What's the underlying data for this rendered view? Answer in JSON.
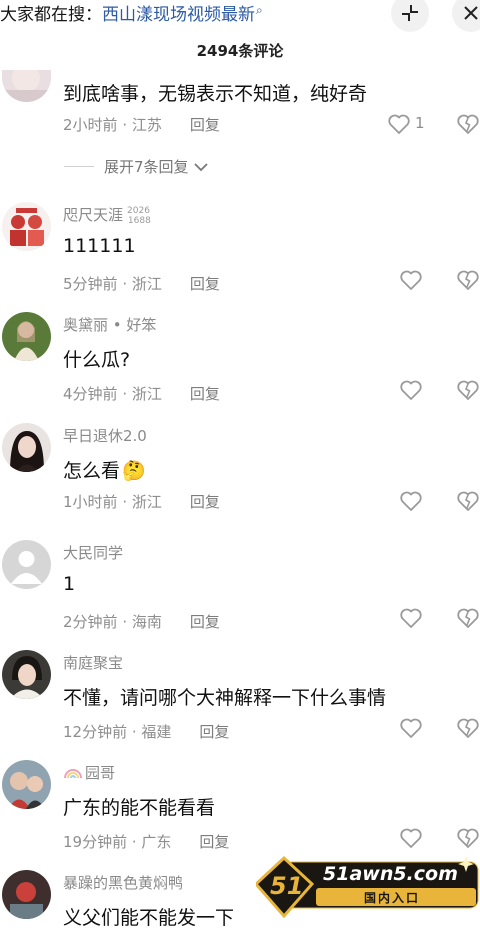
{
  "search": {
    "label": "大家都在搜：",
    "term": "西山漾现场视频最新",
    "icon": "search-icon"
  },
  "header": {
    "comment_count": "2494条评论"
  },
  "expand": {
    "label": "展开7条回复"
  },
  "comments": [
    {
      "username": "",
      "text": "到底啥事，无锡表示不知道，纯好奇",
      "time": "2小时前",
      "location": "江苏",
      "reply": "回复",
      "likes": "1"
    },
    {
      "username": "咫尺天涯",
      "badge_top": "2026",
      "badge_bottom": "1688",
      "text": "111111",
      "time": "5分钟前",
      "location": "浙江",
      "reply": "回复"
    },
    {
      "username": "奥黛丽 • 好笨",
      "text": "什么瓜?",
      "time": "4分钟前",
      "location": "浙江",
      "reply": "回复"
    },
    {
      "username": "早日退休2.0",
      "text": "怎么看",
      "emoji": "🤔",
      "time": "1小时前",
      "location": "浙江",
      "reply": "回复"
    },
    {
      "username": "大民同学",
      "text": "1",
      "time": "2分钟前",
      "location": "海南",
      "reply": "回复"
    },
    {
      "username": "南庭聚宝",
      "text": "不懂，请问哪个大神解释一下什么事情",
      "time": "12分钟前",
      "location": "福建",
      "reply": "回复"
    },
    {
      "username": "园哥",
      "username_prefix_icon": "rainbow-icon",
      "text": "广东的能不能看看",
      "time": "19分钟前",
      "location": "广东",
      "reply": "回复"
    },
    {
      "username": "暴躁的黑色黄焖鸭",
      "text": "义父们能不能发一下"
    }
  ],
  "watermark": {
    "logo_number": "51",
    "site": "51awn5.com",
    "caption": "国内入口"
  },
  "colors": {
    "link_blue": "#2c5aa5",
    "meta_gray": "#8e8e8e",
    "watermark_gold": "#e8b53a"
  }
}
